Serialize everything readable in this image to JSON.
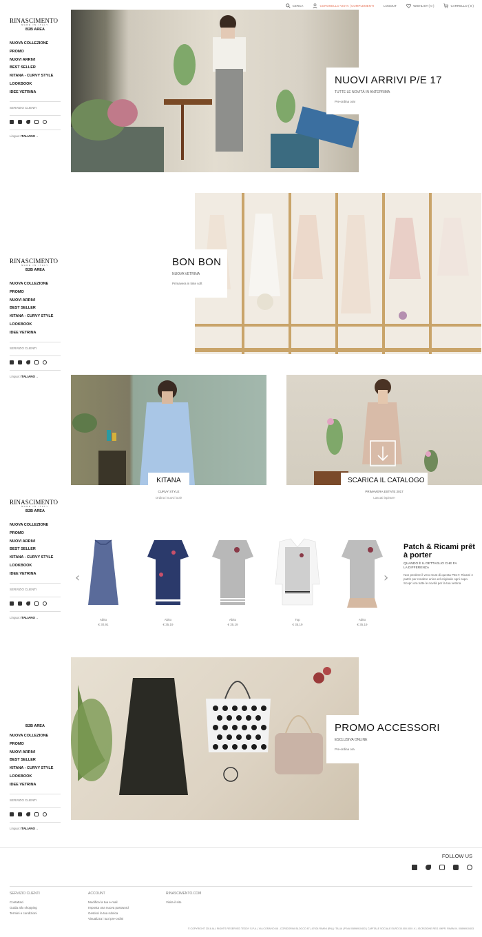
{
  "topbar": {
    "search": "CERCA",
    "orders": "CORONELLO VISTA | COMPLEMENTI",
    "logout": "LOGOUT",
    "wishlist": "WISHLIST ( 0 )",
    "cart": "CARRELLO ( 0 )"
  },
  "sidebar": {
    "logo": "RINASCIMENTO",
    "logo_sub": "MADE IN ITALY",
    "b2b": "B2B AREA",
    "nav": [
      "NUOVA COLLEZIONE",
      "PROMO",
      "NUOVI ARRIVI",
      "BEST SELLER",
      "KITANA - CURVY STYLE",
      "LOOKBOOK",
      "IDEE VETRINA"
    ],
    "service": "SERVIZIO CLIENTI",
    "lang_label": "Lingua:",
    "lang_value": "ITALIANO"
  },
  "hero1": {
    "title": "NUOVI ARRIVI P/E 17",
    "subtitle": "TUTTE LE NOVITÀ IN ANTEPRIMA",
    "cta": "Pre-ordina ora!"
  },
  "hero2": {
    "title": "BON BON",
    "subtitle": "NUOVA VETRINA",
    "cta": "Primavera in tinte soft"
  },
  "tiles": [
    {
      "label": "KITANA",
      "sub": "CURVY STYLE",
      "sub2": "Ordina i nuovi look!"
    },
    {
      "label": "SCARICA IL CATALOGO",
      "sub": "PRIMAVERA ESTATE 2017",
      "sub2": "Lascati ispirare!"
    }
  ],
  "products": [
    {
      "name": "Abito",
      "price": "€ 30,91",
      "color": "#5a6b9a"
    },
    {
      "name": "Abito",
      "price": "€ 35,19",
      "color": "#2b3a6b"
    },
    {
      "name": "Abito",
      "price": "€ 35,19",
      "color": "#b8b8b8"
    },
    {
      "name": "Top",
      "price": "€ 35,19",
      "color": "#cfcfcf"
    },
    {
      "name": "Abito",
      "price": "€ 35,19",
      "color": "#bdbdbd"
    }
  ],
  "feature": {
    "title": "Patch & Ricami prêt à porter",
    "subtitle": "QUANDO È IL DETTAGLIO CHE FA LA DIFFERENZA",
    "text": "Non perdere il vero must di questa PE17: Ricami e patch per rendere unico ed originale ogni capo. Scopri ora tutte le novità per la tua vetrina"
  },
  "hero3": {
    "title": "PROMO ACCESSORI",
    "subtitle": "ESCLUSIVA ONLINE",
    "cta": "Pre-ordina ora"
  },
  "footer": {
    "follow": "FOLLOW US",
    "col1_title": "SERVIZIO CLIENTI",
    "col1": [
      "Contattaci",
      "Guida allo shopping",
      "Termini e condizioni"
    ],
    "col2_title": "ACCOUNT",
    "col2": [
      "Modifica la tua e-mail",
      "Imposta una nuova password",
      "Gestisci la tua rubrica",
      "Visualizza i tuoi pre-ordini"
    ],
    "col3_title": "RINASCIMENTO.COM",
    "col3": [
      "Visita il sito"
    ],
    "copyright": "© COPYRIGHT 2016 ALL RIGHTS RESERVED TEDDY S.P.A. | VIA CORAVIO 88 - CORIDORINI BLOCCO 87 | 47924 RIMINI (RN) | ITALIA | P.IVA 00896910403 | CAPITALE SOCIALE EURO 30.000.000 I.V. | ISCRIZIONE REG. IMPR. RIMINI N. 00896910403"
  }
}
